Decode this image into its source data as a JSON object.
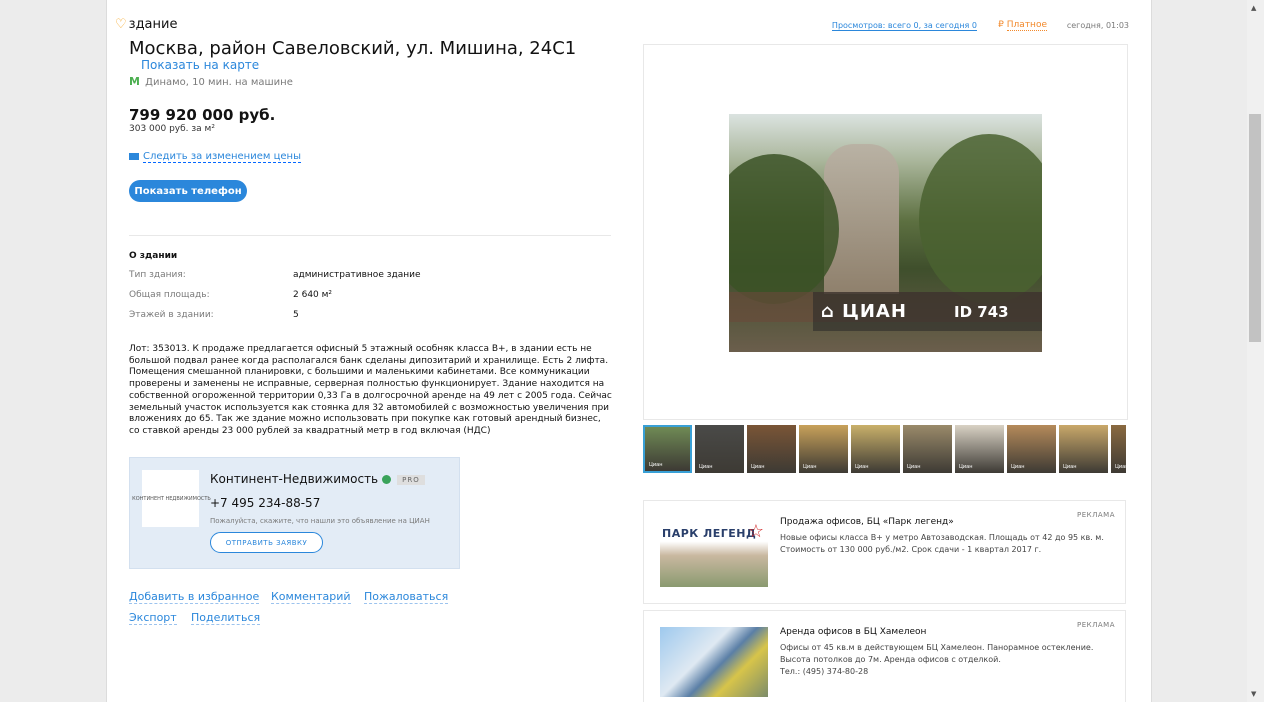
{
  "listing": {
    "type": "здание",
    "address": "Москва, район Савеловский, ул. Мишина, 24С1",
    "show_map": "Показать на карте",
    "metro_icon": "М",
    "metro_name": "Динамо,",
    "metro_time": "10 мин. на машине",
    "price": "799 920 000 руб.",
    "price_per_m2": "303 000 руб. за м²",
    "track_price": "Следить за изменением цены",
    "show_phone": "Показать телефон"
  },
  "about": {
    "title": "О здании",
    "rows": [
      {
        "label": "Тип здания:",
        "value": "административное здание"
      },
      {
        "label": "Общая площадь:",
        "value": "2 640 м²"
      },
      {
        "label": "Этажей в здании:",
        "value": "5"
      }
    ]
  },
  "description": "Лот: 353013. К продаже предлагается офисный 5 этажный особняк класса В+, в здании есть не большой подвал ранее когда располагался банк сделаны дипозитарий и хранилище. Есть 2 лифта. Помещения смешанной планировки, с большими и маленькими кабинетами. Все коммуникации проверены и заменены не исправные, серверная полностью функционирует. Здание находится на собственной огороженной территории 0,33 Га в долгосрочной аренде на 49 лет с 2005 года. Сейчас земельный участок используется как стоянка для 32 автомобилей с возможностью увеличения при вложениях до 65. Так же здание можно использовать при покупке как готовый арендный бизнес, со ставкой аренды 23 000 рублей за квадратный метр в год включая (НДС)",
  "agent": {
    "logo_text": "КОНТИНЕНТ НЕДВИЖИМОСТЬ",
    "name": "Континент-Недвижимость",
    "pro": "PRO",
    "phone": "+7 495 234-88-57",
    "hint": "Пожалуйста, скажите, что нашли это объявление на ЦИАН",
    "request": "ОТПРАВИТЬ ЗАЯВКУ"
  },
  "actions": {
    "favorite": "Добавить в избранное",
    "comment": "Комментарий",
    "complain": "Пожаловаться",
    "export": "Экспорт",
    "share": "Поделиться"
  },
  "meta": {
    "views": "Просмотров: всего 0, за сегодня 0",
    "paid_icon": "₽",
    "paid": "Платное",
    "date": "сегодня, 01:03"
  },
  "gallery": {
    "watermark_brand": "ЦИАН",
    "watermark_id": "ID 743",
    "thumb_count": 10,
    "thumb_label": "Циан"
  },
  "ads": [
    {
      "label": "РЕКЛАМА",
      "image_text": "ПАРК ЛЕГЕНД",
      "title": "Продажа офисов, БЦ «Парк легенд»",
      "text": "Новые офисы класса В+ у метро Автозаводская. Площадь от 42 до 95 кв. м. Стоимость от 130 000 руб./м2. Срок сдачи - 1 квартал 2017 г."
    },
    {
      "label": "РЕКЛАМА",
      "title": "Аренда офисов в БЦ Хамелеон",
      "text": "Офисы от 45 кв.м в действующем БЦ Хамелеон. Панорамное остекление. Высота потолков до 7м. Аренда офисов с отделкой.",
      "phone": "Тел.: (495) 374-80-28"
    }
  ],
  "colors": {
    "link": "#2b87db",
    "paid": "#f2892b",
    "agent_bg": "#e3ecf6",
    "metro": "#4caf50"
  }
}
